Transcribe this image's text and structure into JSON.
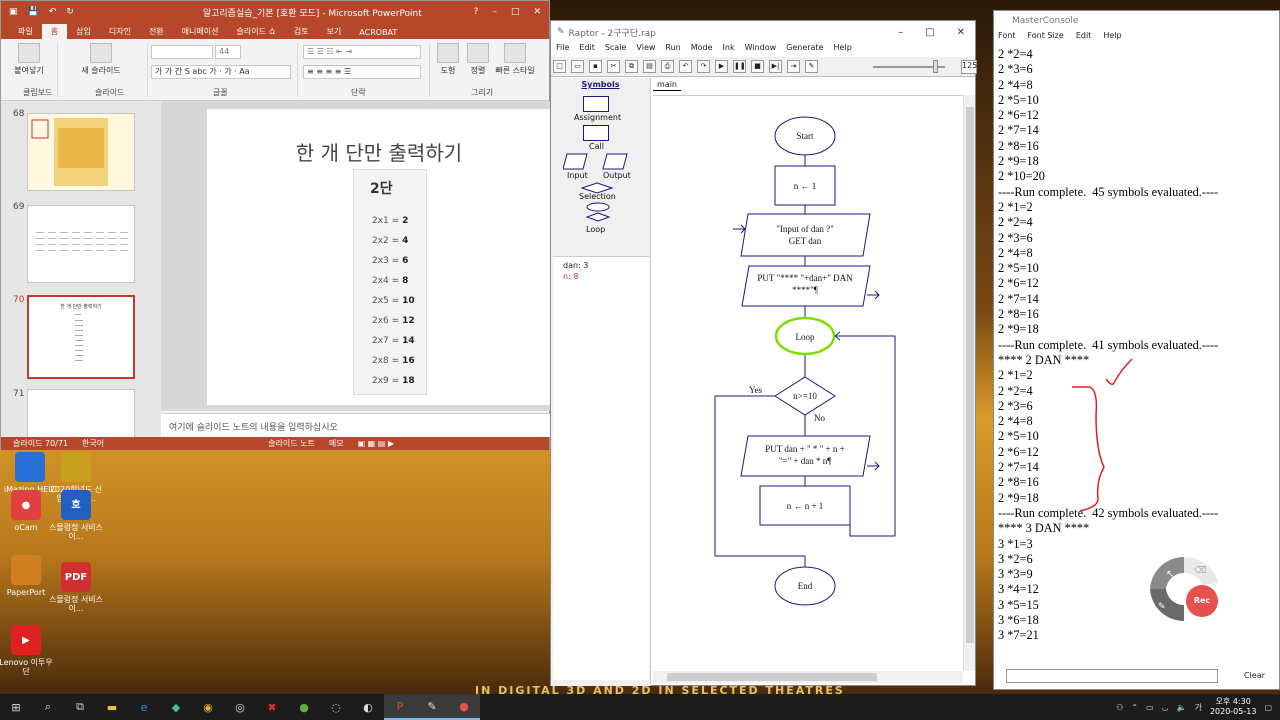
{
  "powerpoint": {
    "title": "알고리즘실습_기본 [호환 모드] - Microsoft PowerPoint",
    "tabs": [
      "파일",
      "홈",
      "삽입",
      "디자인",
      "전환",
      "애니메이션",
      "슬라이드 쇼",
      "검토",
      "보기",
      "ACROBAT"
    ],
    "ribbon": {
      "paste": "붙여넣기",
      "new_slide": "새 슬라이드",
      "font_size": "44",
      "shapes": "도형",
      "arrange": "정렬",
      "quick_styles": "빠른 스타일",
      "groups": [
        "클립보드",
        "슬라이드",
        "글꼴",
        "단락",
        "그리기"
      ]
    },
    "thumbnails": [
      {
        "num": "68"
      },
      {
        "num": "69"
      },
      {
        "num": "70",
        "title": "한 개 단만 출력하기"
      },
      {
        "num": "71"
      }
    ],
    "slide": {
      "title": "한 개 단만 출력하기",
      "dan_label": "2단",
      "rows": [
        {
          "expr": "2x1 =",
          "val": "2"
        },
        {
          "expr": "2x2 =",
          "val": "4"
        },
        {
          "expr": "2x3 =",
          "val": "6"
        },
        {
          "expr": "2x4 =",
          "val": "8"
        },
        {
          "expr": "2x5 =",
          "val": "10"
        },
        {
          "expr": "2x6 =",
          "val": "12"
        },
        {
          "expr": "2x7 =",
          "val": "14"
        },
        {
          "expr": "2x8 =",
          "val": "16"
        },
        {
          "expr": "2x9 =",
          "val": "18"
        }
      ]
    },
    "notes_placeholder": "여기에 슬라이드 노트의 내용을 입력하십시오",
    "status": {
      "slide": "슬라이드 70/71",
      "lang": "한국어",
      "notes": "슬라이드 노트",
      "memo": "메모"
    }
  },
  "raptor": {
    "title": "Raptor - 2구구단.rap",
    "menu": [
      "File",
      "Edit",
      "Scale",
      "View",
      "Run",
      "Mode",
      "Ink",
      "Window",
      "Generate",
      "Help"
    ],
    "zoom": "125",
    "symbols_title": "Symbols",
    "symbols": [
      "Assignment",
      "Call",
      "Input",
      "Output",
      "Selection",
      "Loop"
    ],
    "watch": [
      "dan: 3",
      "n: 8"
    ],
    "tab": "main",
    "flowchart": {
      "start": "Start",
      "assign1": "n ← 1",
      "input_line1": "\"Input of dan ?\"",
      "input_line2": "GET dan",
      "output1_line1": "PUT \"**** \"+dan+\" DAN",
      "output1_line2": "****\"¶",
      "loop": "Loop",
      "cond": "n>=10",
      "yes": "Yes",
      "no": "No",
      "output2_line1": "PUT dan + \" * \" + n +",
      "output2_line2": "\"=\" + dan * n¶",
      "assign2": "n ← n + 1",
      "end": "End"
    }
  },
  "console": {
    "title": "MasterConsole",
    "menu": [
      "Font",
      "Font Size",
      "Edit",
      "Help"
    ],
    "lines": [
      "2 *2=4",
      "2 *3=6",
      "2 *4=8",
      "2 *5=10",
      "2 *6=12",
      "2 *7=14",
      "2 *8=16",
      "2 *9=18",
      "2 *10=20",
      "----Run complete.  45 symbols evaluated.----",
      "2 *1=2",
      "2 *2=4",
      "2 *3=6",
      "2 *4=8",
      "2 *5=10",
      "2 *6=12",
      "2 *7=14",
      "2 *8=16",
      "2 *9=18",
      "----Run complete.  41 symbols evaluated.----",
      "**** 2 DAN ****",
      "2 *1=2",
      "2 *2=4",
      "2 *3=6",
      "2 *4=8",
      "2 *5=10",
      "2 *6=12",
      "2 *7=14",
      "2 *8=16",
      "2 *9=18",
      "----Run complete.  42 symbols evaluated.----",
      "**** 3 DAN ****",
      "3 *1=3",
      "3 *2=6",
      "3 *3=9",
      "3 *4=12",
      "3 *5=15",
      "3 *6=18",
      "3 *7=21"
    ],
    "clear": "Clear",
    "rec": "Rec"
  },
  "desktop": {
    "icons": [
      {
        "label": "iMazing HEIC C...",
        "color": "#2a6fd6"
      },
      {
        "label": "2020학년도 신입생 학생...",
        "color": "#c8a020"
      },
      {
        "label": "oCam",
        "color": "#e04040"
      },
      {
        "label": "스물렁정 서비스 이...",
        "color": "#2060c0"
      },
      {
        "label": "PaperPort",
        "color": "#d08020"
      },
      {
        "label": "스물렁정 서비스 이...",
        "color": "#d03030"
      },
      {
        "label": "Lenovo 이투우단",
        "color": "#e02020"
      }
    ],
    "bg_text": "IN DIGITAL 3D AND 2D IN SELECTED THEATRES"
  },
  "taskbar": {
    "clock_time": "오후 4:30",
    "clock_date": "2020-05-13",
    "ime": "가"
  },
  "colors": {
    "ppt_accent": "#b7472a",
    "raptor_shape": "#1a1a80",
    "loop_highlight": "#7fdc00",
    "annotation_red": "#e02020"
  }
}
